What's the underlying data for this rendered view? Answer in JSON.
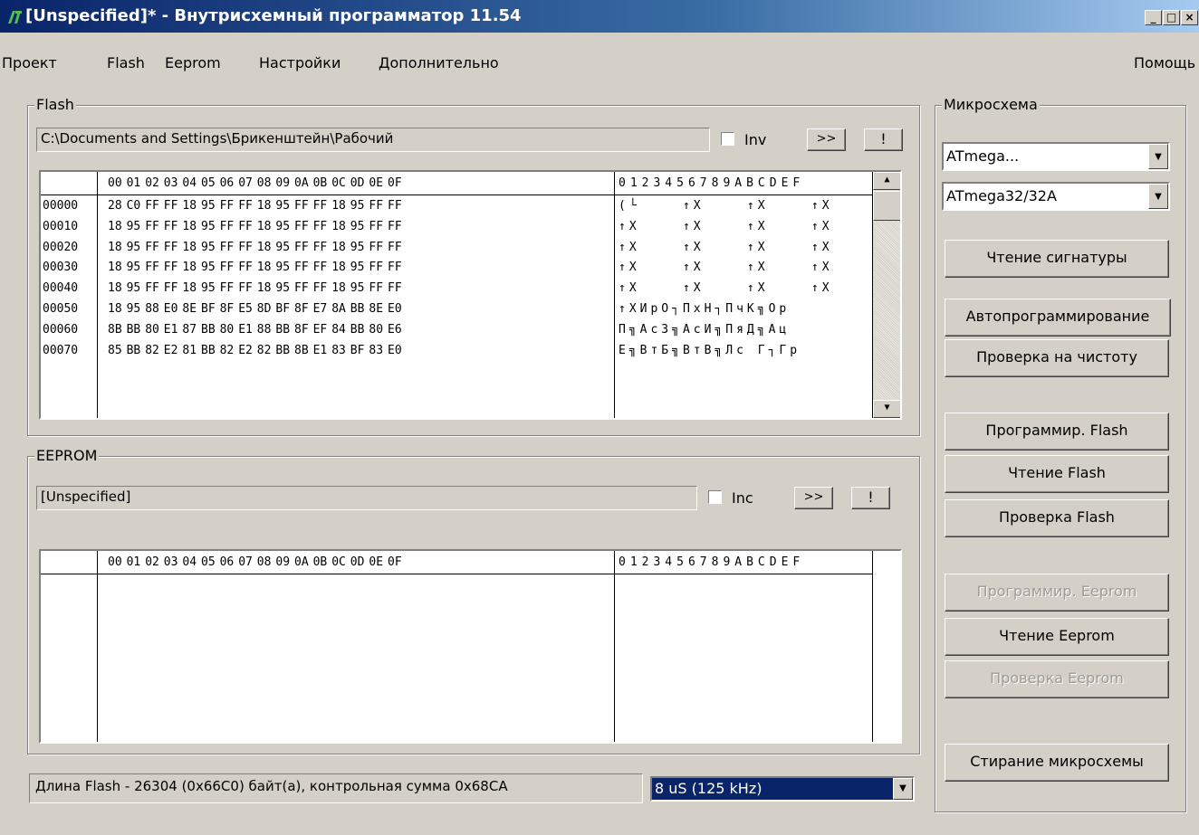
{
  "window": {
    "title": "[Unspecified]* - Внутрисхемный программатор 11.54"
  },
  "menu": {
    "items": [
      "Проект",
      "Flash",
      "Eeprom",
      "Настройки",
      "Дополнительно"
    ],
    "help": "Помощь"
  },
  "flash": {
    "legend": "Flash",
    "path": "C:\\Documents and Settings\\Брикенштейн\\Рабочий",
    "inv_label": "Inv",
    "inv_checked": false,
    "more_label": ">>",
    "warn_label": "!",
    "col_headers": [
      "00",
      "01",
      "02",
      "03",
      "04",
      "05",
      "06",
      "07",
      "08",
      "09",
      "0A",
      "0B",
      "0C",
      "0D",
      "0E",
      "0F"
    ],
    "ascii_header": "0123456789ABCDEF",
    "rows": [
      {
        "addr": "00000",
        "bytes": [
          "28",
          "C0",
          "FF",
          "FF",
          "18",
          "95",
          "FF",
          "FF",
          "18",
          "95",
          "FF",
          "FF",
          "18",
          "95",
          "FF",
          "FF"
        ],
        "ascii": "(└    ↑Х    ↑Х    ↑Х  "
      },
      {
        "addr": "00010",
        "bytes": [
          "18",
          "95",
          "FF",
          "FF",
          "18",
          "95",
          "FF",
          "FF",
          "18",
          "95",
          "FF",
          "FF",
          "18",
          "95",
          "FF",
          "FF"
        ],
        "ascii": "↑Х    ↑Х    ↑Х    ↑Х  "
      },
      {
        "addr": "00020",
        "bytes": [
          "18",
          "95",
          "FF",
          "FF",
          "18",
          "95",
          "FF",
          "FF",
          "18",
          "95",
          "FF",
          "FF",
          "18",
          "95",
          "FF",
          "FF"
        ],
        "ascii": "↑Х    ↑Х    ↑Х    ↑Х  "
      },
      {
        "addr": "00030",
        "bytes": [
          "18",
          "95",
          "FF",
          "FF",
          "18",
          "95",
          "FF",
          "FF",
          "18",
          "95",
          "FF",
          "FF",
          "18",
          "95",
          "FF",
          "FF"
        ],
        "ascii": "↑Х    ↑Х    ↑Х    ↑Х  "
      },
      {
        "addr": "00040",
        "bytes": [
          "18",
          "95",
          "FF",
          "FF",
          "18",
          "95",
          "FF",
          "FF",
          "18",
          "95",
          "FF",
          "FF",
          "18",
          "95",
          "FF",
          "FF"
        ],
        "ascii": "↑Х    ↑Х    ↑Х    ↑Х  "
      },
      {
        "addr": "00050",
        "bytes": [
          "18",
          "95",
          "88",
          "E0",
          "8E",
          "BF",
          "8F",
          "E5",
          "8D",
          "BF",
          "8F",
          "E7",
          "8A",
          "BB",
          "8E",
          "E0"
        ],
        "ascii": "↑ХИрО┐ПхН┐ПчК╗Ор"
      },
      {
        "addr": "00060",
        "bytes": [
          "8B",
          "BB",
          "80",
          "E1",
          "87",
          "BB",
          "80",
          "E1",
          "88",
          "BB",
          "8F",
          "EF",
          "84",
          "BB",
          "80",
          "E6"
        ],
        "ascii": "П╗Ас3╗АсИ╗ПяД╗Ац"
      },
      {
        "addr": "00070",
        "bytes": [
          "85",
          "BB",
          "82",
          "E2",
          "81",
          "BB",
          "82",
          "E2",
          "82",
          "BB",
          "8B",
          "E1",
          "83",
          "BF",
          "83",
          "E0"
        ],
        "ascii": "Е╗ВтБ╗ВтВ╗Лс Г┐Гр"
      }
    ]
  },
  "eeprom": {
    "legend": "EEPROM",
    "path": "[Unspecified]",
    "inc_label": "Inc",
    "inc_checked": false,
    "more_label": ">>",
    "warn_label": "!",
    "col_headers": [
      "00",
      "01",
      "02",
      "03",
      "04",
      "05",
      "06",
      "07",
      "08",
      "09",
      "0A",
      "0B",
      "0C",
      "0D",
      "0E",
      "0F"
    ],
    "ascii_header": "0123456789ABCDEF"
  },
  "chip": {
    "legend": "Микросхема",
    "family": "ATmega...",
    "model": "ATmega32/32A",
    "buttons": {
      "read_sig": "Чтение сигнатуры",
      "autoprog": "Автопрограммирование",
      "blank_check": "Проверка на чистоту",
      "prog_flash": "Программир. Flash",
      "read_flash": "Чтение Flash",
      "verify_flash": "Проверка Flash",
      "prog_eeprom": "Программир. Eeprom",
      "read_eeprom": "Чтение Eeprom",
      "verify_eeprom": "Проверка Eeprom",
      "erase": "Стирание микросхемы"
    }
  },
  "status": {
    "text": "Длина Flash - 26304 (0x66C0) байт(а), контрольная сумма 0x68CA",
    "speed": "8 uS (125 kHz)"
  }
}
